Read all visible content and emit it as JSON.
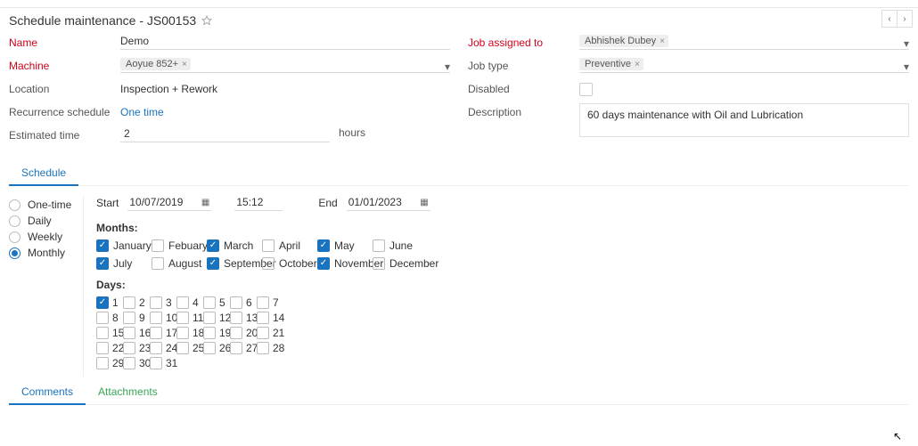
{
  "header": {
    "title": "Schedule maintenance - JS00153"
  },
  "form_left": {
    "name": {
      "label": "Name",
      "value": "Demo"
    },
    "machine": {
      "label": "Machine",
      "token": "Aoyue 852+"
    },
    "location": {
      "label": "Location",
      "value": "Inspection + Rework"
    },
    "recurrence": {
      "label": "Recurrence schedule",
      "value": "One time"
    },
    "estimated": {
      "label": "Estimated time",
      "value": "2",
      "unit": "hours"
    }
  },
  "form_right": {
    "assigned": {
      "label": "Job assigned to",
      "token": "Abhishek Dubey"
    },
    "job_type": {
      "label": "Job type",
      "token": "Preventive"
    },
    "disabled": {
      "label": "Disabled"
    },
    "description": {
      "label": "Description",
      "value": "60 days maintenance with Oil and Lubrication"
    }
  },
  "tabs": {
    "schedule": "Schedule"
  },
  "frequency": {
    "one_time": "One-time",
    "daily": "Daily",
    "weekly": "Weekly",
    "monthly": "Monthly",
    "selected": "monthly"
  },
  "datetime": {
    "start_label": "Start",
    "start_date": "10/07/2019",
    "start_time": "15:12",
    "end_label": "End",
    "end_date": "01/01/2023"
  },
  "months": {
    "label": "Months:",
    "list": [
      {
        "name": "January",
        "checked": true
      },
      {
        "name": "Febuary",
        "checked": false
      },
      {
        "name": "March",
        "checked": true
      },
      {
        "name": "April",
        "checked": false
      },
      {
        "name": "May",
        "checked": true
      },
      {
        "name": "June",
        "checked": false
      },
      {
        "name": "July",
        "checked": true
      },
      {
        "name": "August",
        "checked": false
      },
      {
        "name": "September",
        "checked": true
      },
      {
        "name": "October",
        "checked": false
      },
      {
        "name": "November",
        "checked": true
      },
      {
        "name": "December",
        "checked": false
      }
    ]
  },
  "days": {
    "label": "Days:",
    "selected": [
      1
    ]
  },
  "bottom_tabs": {
    "comments": "Comments",
    "attachments": "Attachments"
  }
}
